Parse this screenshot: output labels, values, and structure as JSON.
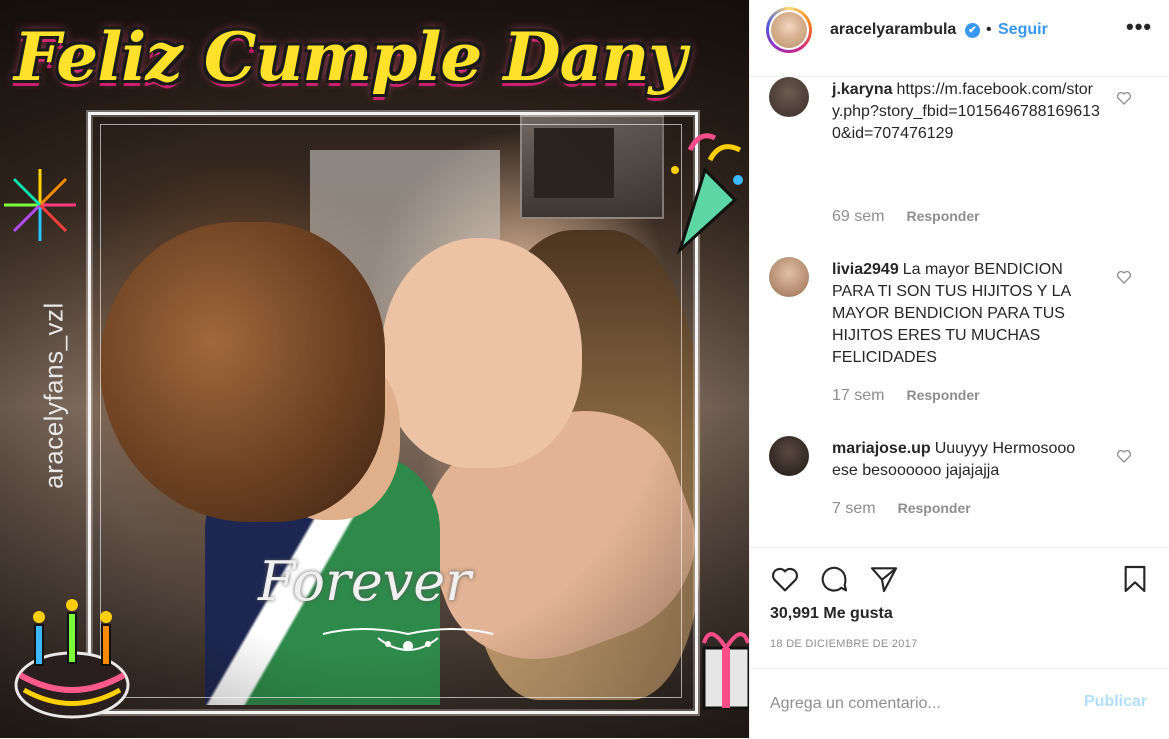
{
  "post": {
    "title_overlay": "Feliz Cumple Dany",
    "watermark": "aracelyfans_vzl",
    "overlay_word": "Forever"
  },
  "header": {
    "username": "aracelyarambula",
    "verified_glyph": "✔",
    "separator": "•",
    "follow_label": "Seguir",
    "more_label": "•••"
  },
  "comments": [
    {
      "username": "j.karyna",
      "text": "https://m.facebook.com/story.php?story_fbid=10156467881696130&id=707476129",
      "time": "69 sem",
      "reply_label": "Responder",
      "avatar_color": "#3a2e28"
    },
    {
      "username": "livia2949",
      "text": "La mayor BENDICION PARA TI SON TUS HIJITOS Y LA MAYOR BENDICION PARA TUS HIJITOS ERES TU MUCHAS FELICIDADES",
      "time": "17 sem",
      "reply_label": "Responder",
      "avatar_color": "#c79a78"
    },
    {
      "username": "mariajose.up",
      "text": "Uuuyyy Hermosooo ese besoooooo jajajajja",
      "time": "7 sem",
      "reply_label": "Responder",
      "avatar_color": "#2b2420"
    }
  ],
  "actions": {
    "icons": [
      "heart-icon",
      "comment-icon",
      "share-icon",
      "bookmark-icon"
    ],
    "likes_text": "30,991 Me gusta",
    "date_text": "18 DE DICIEMBRE DE 2017"
  },
  "comment_box": {
    "placeholder": "Agrega un comentario...",
    "publish_label": "Publicar"
  },
  "colors": {
    "accent": "#3897f0",
    "muted": "#8e8e8e",
    "publish_disabled": "#b2dffc",
    "title_yellow": "#ffe02a"
  }
}
